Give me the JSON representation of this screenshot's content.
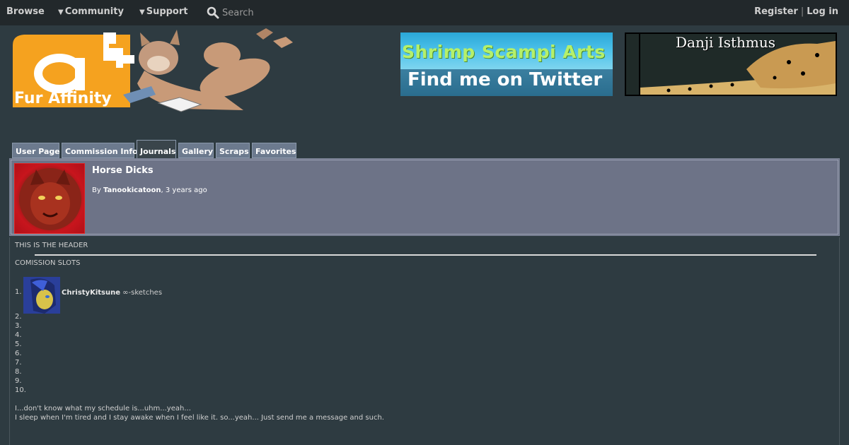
{
  "nav": {
    "browse": "Browse",
    "community": "Community",
    "support": "Support",
    "search_placeholder": "Search",
    "register": "Register",
    "separator": "|",
    "login": "Log in"
  },
  "logo": {
    "text": "Fur Affinity",
    "letter": "a"
  },
  "banners": {
    "left": {
      "title": "Shrimp Scampi Arts",
      "subtitle": "Find me on Twitter"
    },
    "right": {
      "title": "Danji Isthmus"
    }
  },
  "tabs": [
    {
      "label": "User Page"
    },
    {
      "label": "Commission Info"
    },
    {
      "label": "Journals"
    },
    {
      "label": "Gallery"
    },
    {
      "label": "Scraps"
    },
    {
      "label": "Favorites"
    }
  ],
  "journal": {
    "title": "Horse Dicks",
    "by_prefix": "By",
    "author": "Tanookicatoon",
    "time": ", 3 years ago"
  },
  "body": {
    "header_line": "THIS IS THE HEADER",
    "slots_heading": "COMISSION SLOTS",
    "slot1_num": "1.",
    "slot1_user": "ChristyKitsune",
    "slot1_note": " ∞-sketches",
    "slot_numbers": [
      "2.",
      "3.",
      "4.",
      "5.",
      "6.",
      "7.",
      "8.",
      "9.",
      "10."
    ],
    "para1": "I...don't know what my schedule is...uhm...yeah...",
    "para2": "I sleep when I'm tired and I stay awake when I feel like it. so...yeah... Just send me a message and such."
  },
  "colors": {
    "page_bg": "#2e3b41",
    "nav_bg": "#22282b",
    "tab_bg": "#6c7a8e",
    "panel_bg": "#6d7387",
    "logo_orange": "#f5a21f"
  }
}
